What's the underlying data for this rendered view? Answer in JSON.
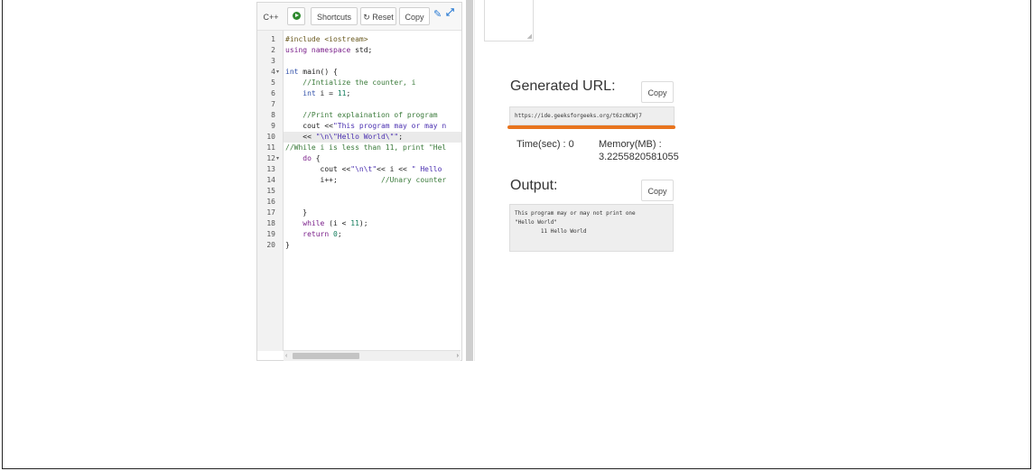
{
  "toolbar": {
    "language": "C++",
    "shortcuts": "Shortcuts",
    "reset": "↻ Reset",
    "copy": "Copy",
    "edit_icon": "✎",
    "fullscreen_icon": "⤢"
  },
  "editor": {
    "highlighted_line": 10,
    "lines": [
      {
        "n": "1",
        "text": "#include <iostream>"
      },
      {
        "n": "2",
        "text": "using namespace std;"
      },
      {
        "n": "3",
        "text": ""
      },
      {
        "n": "4",
        "text": "int main() {",
        "fold": "▾"
      },
      {
        "n": "5",
        "text": "    //Intialize the counter, i"
      },
      {
        "n": "6",
        "text": "    int i = 11;"
      },
      {
        "n": "7",
        "text": ""
      },
      {
        "n": "8",
        "text": "    //Print explaination of program"
      },
      {
        "n": "9",
        "text": "    cout <<\"This program may or may n"
      },
      {
        "n": "10",
        "text": "    << \"\\n\\\"Hello World\\\"\";"
      },
      {
        "n": "11",
        "text": "//While i is less than 11, print \"Hel"
      },
      {
        "n": "12",
        "text": "    do {",
        "fold": "▾"
      },
      {
        "n": "13",
        "text": "        cout <<\"\\n\\t\"<< i << \" Hello"
      },
      {
        "n": "14",
        "text": "        i++;          //Unary counter"
      },
      {
        "n": "15",
        "text": ""
      },
      {
        "n": "16",
        "text": ""
      },
      {
        "n": "17",
        "text": "    }"
      },
      {
        "n": "18",
        "text": "    while (i < 11);"
      },
      {
        "n": "19",
        "text": "    return 0;"
      },
      {
        "n": "20",
        "text": "}"
      }
    ],
    "scroll_left": "‹",
    "scroll_right": "›"
  },
  "result": {
    "generated_url_title": "Generated URL:",
    "copy_label": "Copy",
    "url": "https://ide.geeksforgeeks.org/t6zcNCWj7",
    "time_label": "Time(sec) : 0",
    "memory_label": "Memory(MB) :",
    "memory_value": "3.2255820581055",
    "output_title": "Output:",
    "output_lines": [
      "This program may or may not print one",
      "\"Hello World\"",
      "        11 Hello World"
    ]
  },
  "colors": {
    "accent_underline": "#e8741e",
    "run_icon": "#2f8a2f",
    "link_icon": "#2a7bd3"
  }
}
